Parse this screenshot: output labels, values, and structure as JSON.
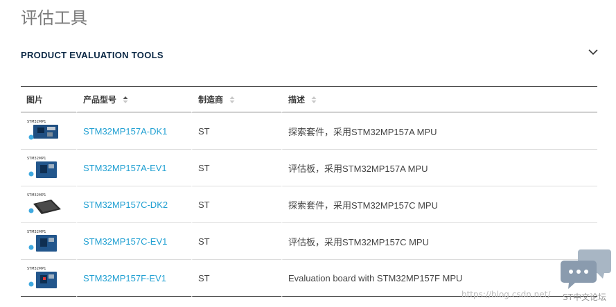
{
  "page": {
    "title": "评估工具"
  },
  "section": {
    "title": "PRODUCT EVALUATION TOOLS"
  },
  "table": {
    "headers": {
      "image": "图片",
      "part": "产品型号",
      "maker": "制造商",
      "desc": "描述"
    },
    "rows": [
      {
        "part": "STM32MP157A-DK1",
        "maker": "ST",
        "desc": "探索套件，采用STM32MP157A MPU",
        "thumb_label": "STM32MP1"
      },
      {
        "part": "STM32MP157A-EV1",
        "maker": "ST",
        "desc": "评估板，采用STM32MP157A MPU",
        "thumb_label": "STM32MP1"
      },
      {
        "part": "STM32MP157C-DK2",
        "maker": "ST",
        "desc": "探索套件，采用STM32MP157C MPU",
        "thumb_label": "STM32MP1"
      },
      {
        "part": "STM32MP157C-EV1",
        "maker": "ST",
        "desc": "评估板，采用STM32MP157C MPU",
        "thumb_label": "STM32MP1"
      },
      {
        "part": "STM32MP157F-EV1",
        "maker": "ST",
        "desc": "Evaluation board with STM32MP157F MPU",
        "thumb_label": "STM32MP1"
      }
    ]
  },
  "colors": {
    "link": "#21a0d2",
    "title": "#0b2845",
    "chat": "#8fa0b3"
  },
  "watermark": {
    "url": "https://blog.csdn.net/",
    "cn": "ST中文论坛"
  }
}
